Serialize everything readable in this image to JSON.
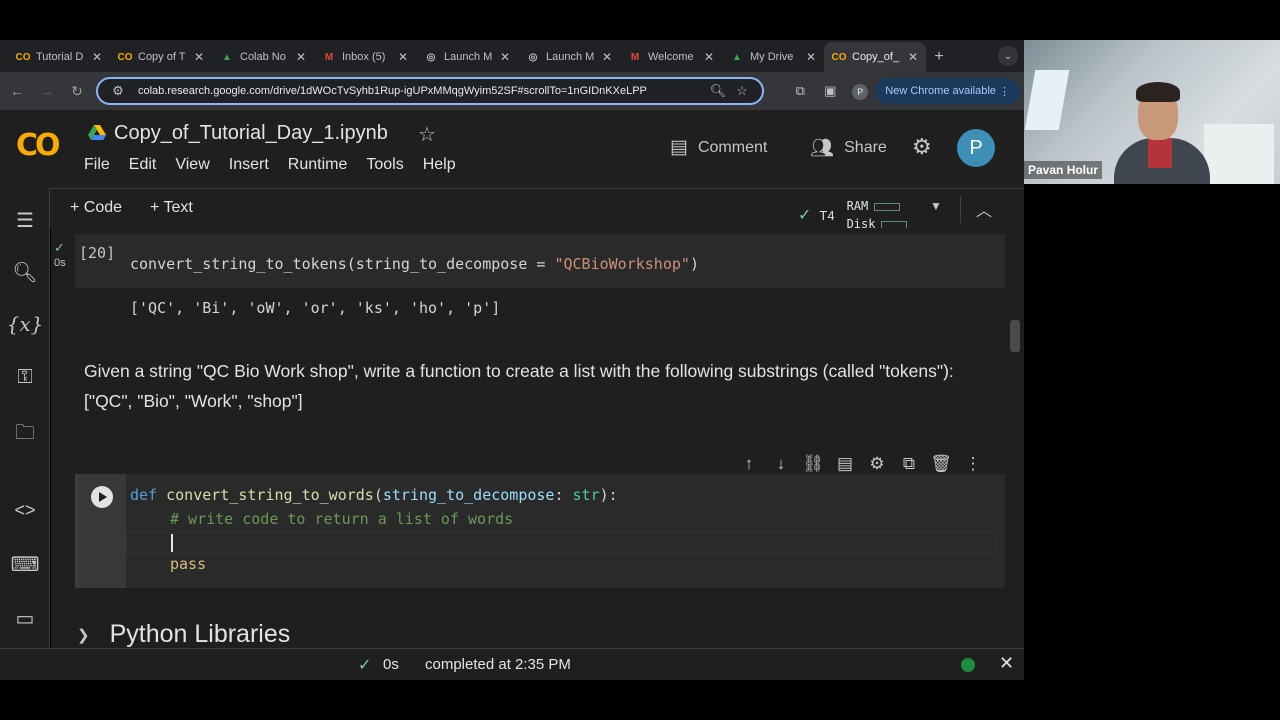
{
  "browser": {
    "tabs": [
      {
        "label": "Tutorial D",
        "favicon": "CO",
        "color": "#f9ab00"
      },
      {
        "label": "Copy of T",
        "favicon": "CO",
        "color": "#f9ab00"
      },
      {
        "label": "Colab No",
        "favicon": "▲",
        "color": "#34a853"
      },
      {
        "label": "Inbox (5)",
        "favicon": "M",
        "color": "#ea4335"
      },
      {
        "label": "Launch M",
        "favicon": "◎",
        "color": "#bdc1c6"
      },
      {
        "label": "Launch M",
        "favicon": "◎",
        "color": "#bdc1c6"
      },
      {
        "label": "Welcome",
        "favicon": "M",
        "color": "#ea4335"
      },
      {
        "label": "My Drive",
        "favicon": "▲",
        "color": "#34a853"
      },
      {
        "label": "Copy_of_",
        "favicon": "CO",
        "color": "#f9ab00"
      }
    ],
    "close_glyph": "✕",
    "new_tab_glyph": "+",
    "url": "colab.research.google.com/drive/1dWOcTvSyhb1Rup-igUPxMMqgWyim52SF#scrollTo=1nGIDnKXeLPP",
    "new_chrome_label": "New Chrome available",
    "profile_initial": "P"
  },
  "colab": {
    "logo_text": "CO",
    "notebook_title": "Copy_of_Tutorial_Day_1.ipynb",
    "menu": [
      "File",
      "Edit",
      "View",
      "Insert",
      "Runtime",
      "Tools",
      "Help"
    ],
    "comment_label": "Comment",
    "share_label": "Share",
    "avatar_initial": "P",
    "add_code_label": "+ Code",
    "add_text_label": "+ Text",
    "runtime_type": "T4",
    "ram_label": "RAM",
    "disk_label": "Disk"
  },
  "cells": {
    "cell1": {
      "exec_count": "[20]",
      "exec_time": "0s",
      "code_fn": "convert_string_to_tokens",
      "code_param": "string_to_decompose",
      "code_eq": " = ",
      "code_string": "\"QCBioWorkshop\"",
      "output": "['QC', 'Bi', 'oW', 'or', 'ks', 'ho', 'p']"
    },
    "markdown": {
      "line1": "Given a string \"QC Bio Work shop\", write a function to create a list with the following substrings (called \"tokens\"):",
      "line2": "[\"QC\", \"Bio\", \"Work\", \"shop\"]"
    },
    "cell2": {
      "kw_def": "def",
      "fn_name": "convert_string_to_words",
      "param": "string_to_decompose",
      "type": "str",
      "comment": "# write code to return a list of words",
      "pass": "pass"
    },
    "section_title": "Python Libraries"
  },
  "status": {
    "time": "0s",
    "text": "completed at 2:35 PM"
  },
  "webcam": {
    "name": "Pavan Holur"
  }
}
